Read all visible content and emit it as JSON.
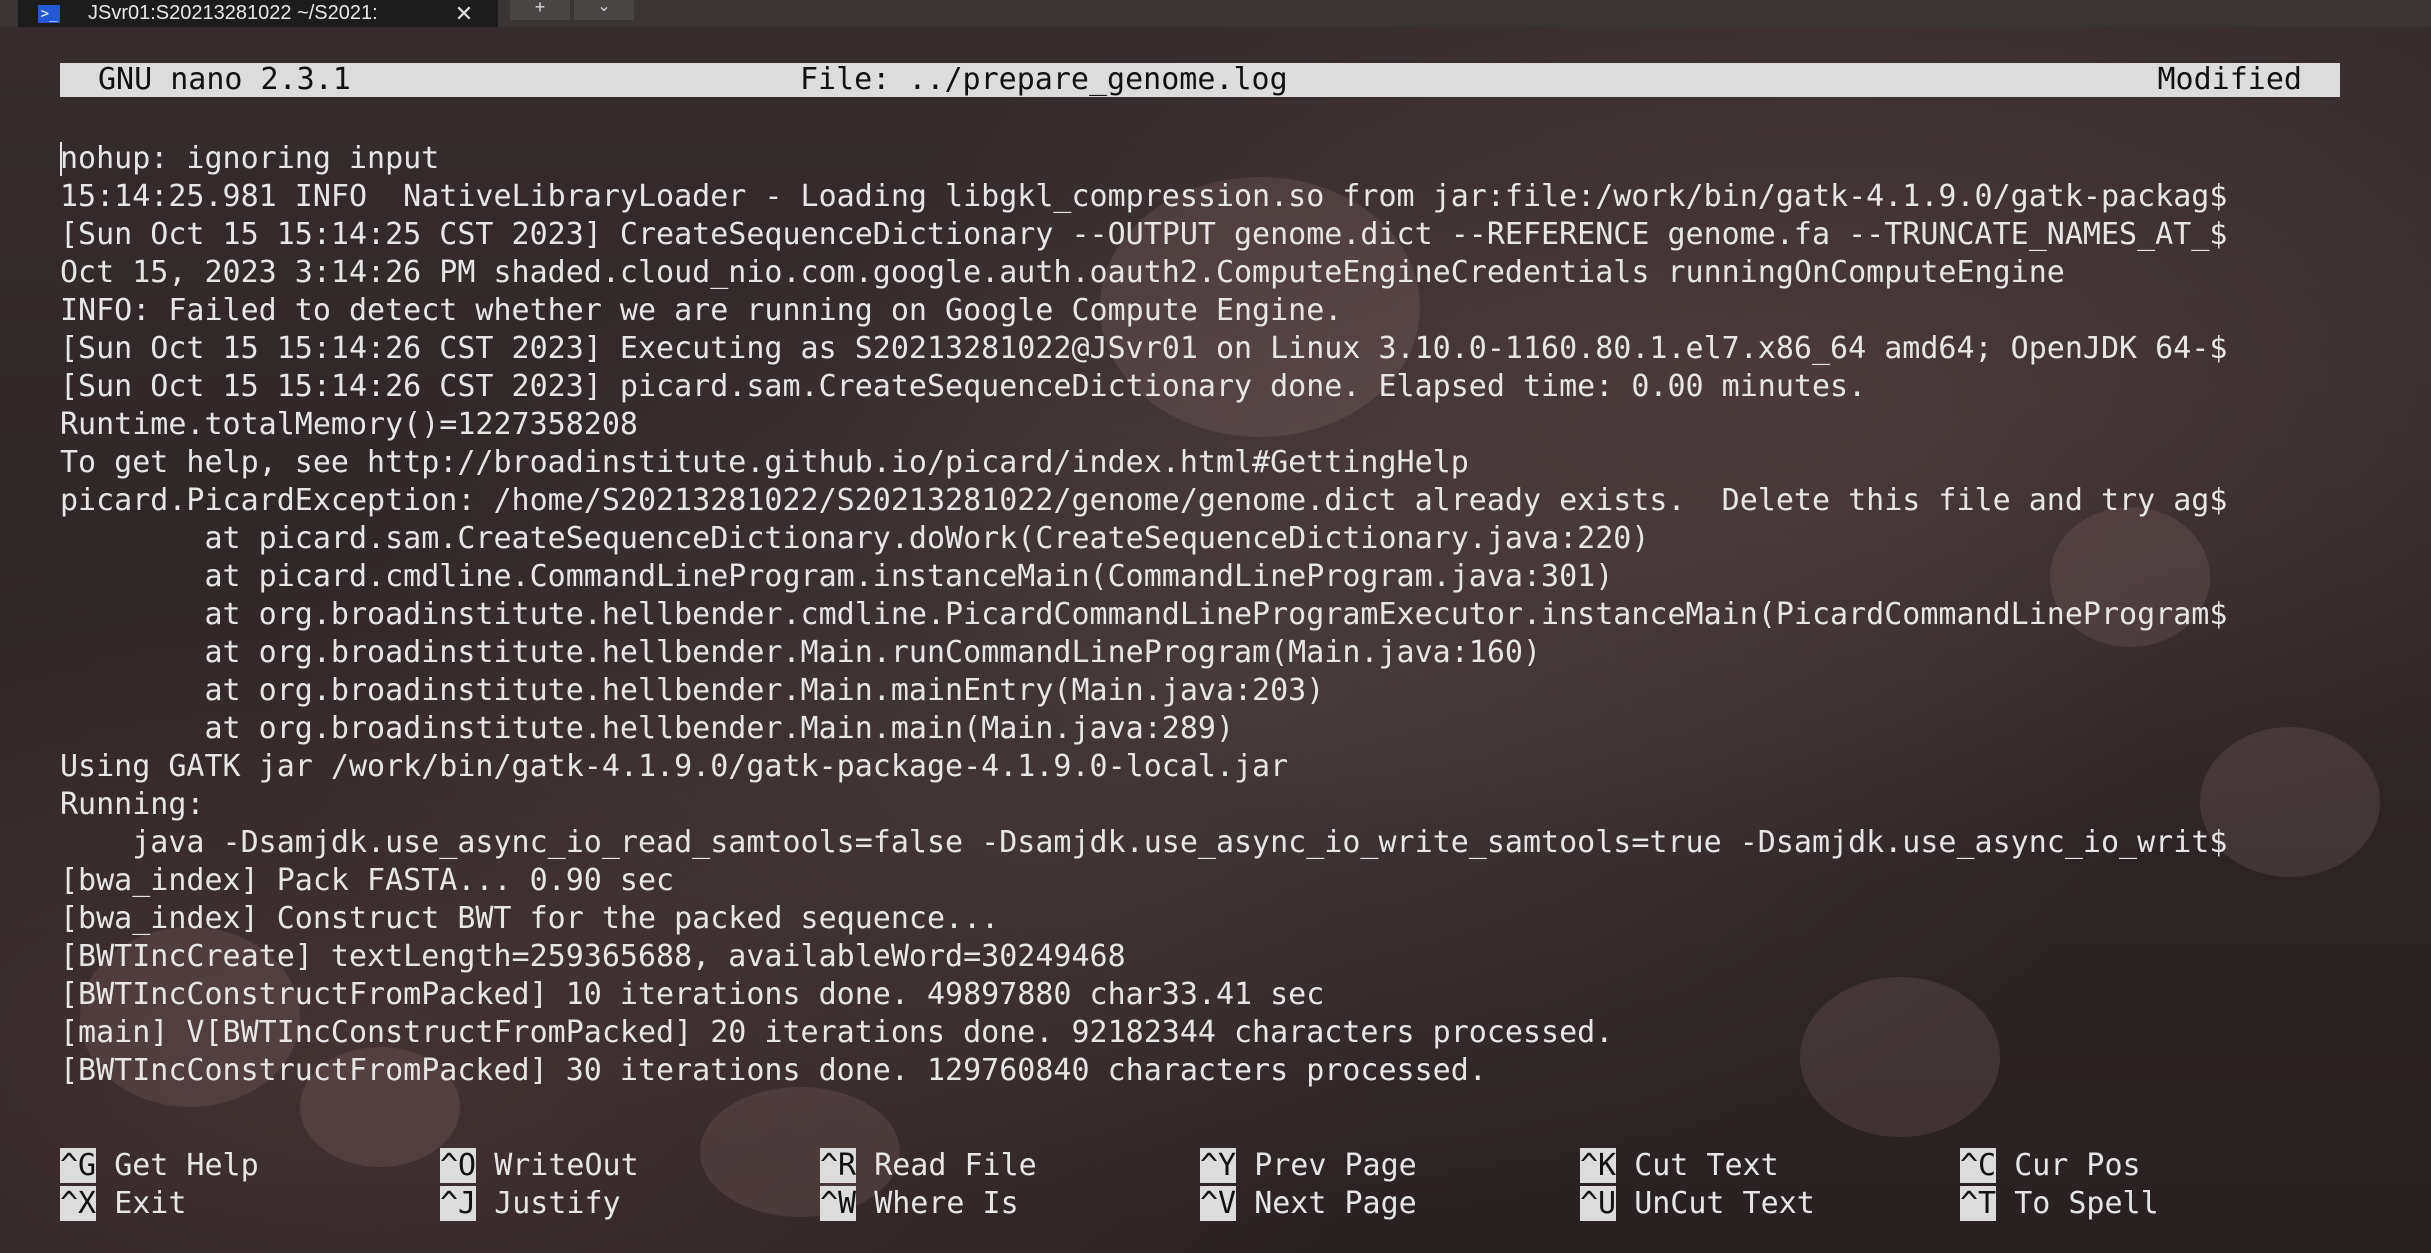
{
  "window": {
    "tab_title": "JSvr01:S20213281022 ~/S2021:",
    "tab_icon": "powershell-icon",
    "close_label": "✕",
    "new_tab_label": "+",
    "dropdown_label": "⌄"
  },
  "nano": {
    "version": "GNU nano 2.3.1",
    "file": "File: ../prepare_genome.log",
    "status": "Modified"
  },
  "log_lines": [
    "nohup: ignoring input",
    "15:14:25.981 INFO  NativeLibraryLoader - Loading libgkl_compression.so from jar:file:/work/bin/gatk-4.1.9.0/gatk-packag$",
    "[Sun Oct 15 15:14:25 CST 2023] CreateSequenceDictionary --OUTPUT genome.dict --REFERENCE genome.fa --TRUNCATE_NAMES_AT_$",
    "Oct 15, 2023 3:14:26 PM shaded.cloud_nio.com.google.auth.oauth2.ComputeEngineCredentials runningOnComputeEngine",
    "INFO: Failed to detect whether we are running on Google Compute Engine.",
    "[Sun Oct 15 15:14:26 CST 2023] Executing as S20213281022@JSvr01 on Linux 3.10.0-1160.80.1.el7.x86_64 amd64; OpenJDK 64-$",
    "[Sun Oct 15 15:14:26 CST 2023] picard.sam.CreateSequenceDictionary done. Elapsed time: 0.00 minutes.",
    "Runtime.totalMemory()=1227358208",
    "To get help, see http://broadinstitute.github.io/picard/index.html#GettingHelp",
    "picard.PicardException: /home/S20213281022/S20213281022/genome/genome.dict already exists.  Delete this file and try ag$",
    "        at picard.sam.CreateSequenceDictionary.doWork(CreateSequenceDictionary.java:220)",
    "        at picard.cmdline.CommandLineProgram.instanceMain(CommandLineProgram.java:301)",
    "        at org.broadinstitute.hellbender.cmdline.PicardCommandLineProgramExecutor.instanceMain(PicardCommandLineProgram$",
    "        at org.broadinstitute.hellbender.Main.runCommandLineProgram(Main.java:160)",
    "        at org.broadinstitute.hellbender.Main.mainEntry(Main.java:203)",
    "        at org.broadinstitute.hellbender.Main.main(Main.java:289)",
    "Using GATK jar /work/bin/gatk-4.1.9.0/gatk-package-4.1.9.0-local.jar",
    "Running:",
    "    java -Dsamjdk.use_async_io_read_samtools=false -Dsamjdk.use_async_io_write_samtools=true -Dsamjdk.use_async_io_writ$",
    "[bwa_index] Pack FASTA... 0.90 sec",
    "[bwa_index] Construct BWT for the packed sequence...",
    "[BWTIncCreate] textLength=259365688, availableWord=30249468",
    "[BWTIncConstructFromPacked] 10 iterations done. 49897880 char33.41 sec",
    "[main] V[BWTIncConstructFromPacked] 20 iterations done. 92182344 characters processed.",
    "[BWTIncConstructFromPacked] 30 iterations done. 129760840 characters processed."
  ],
  "shortcuts": [
    {
      "key": "^G",
      "label": "Get Help"
    },
    {
      "key": "^O",
      "label": "WriteOut"
    },
    {
      "key": "^R",
      "label": "Read File"
    },
    {
      "key": "^Y",
      "label": "Prev Page"
    },
    {
      "key": "^K",
      "label": "Cut Text"
    },
    {
      "key": "^C",
      "label": "Cur Pos"
    },
    {
      "key": "^X",
      "label": "Exit"
    },
    {
      "key": "^J",
      "label": "Justify"
    },
    {
      "key": "^W",
      "label": "Where Is"
    },
    {
      "key": "^V",
      "label": "Next Page"
    },
    {
      "key": "^U",
      "label": "UnCut Text"
    },
    {
      "key": "^T",
      "label": "To Spell"
    }
  ],
  "colors": {
    "terminal_text": "#e6e6e6",
    "bar_background": "#dcdcdc",
    "bar_text": "#111111"
  }
}
